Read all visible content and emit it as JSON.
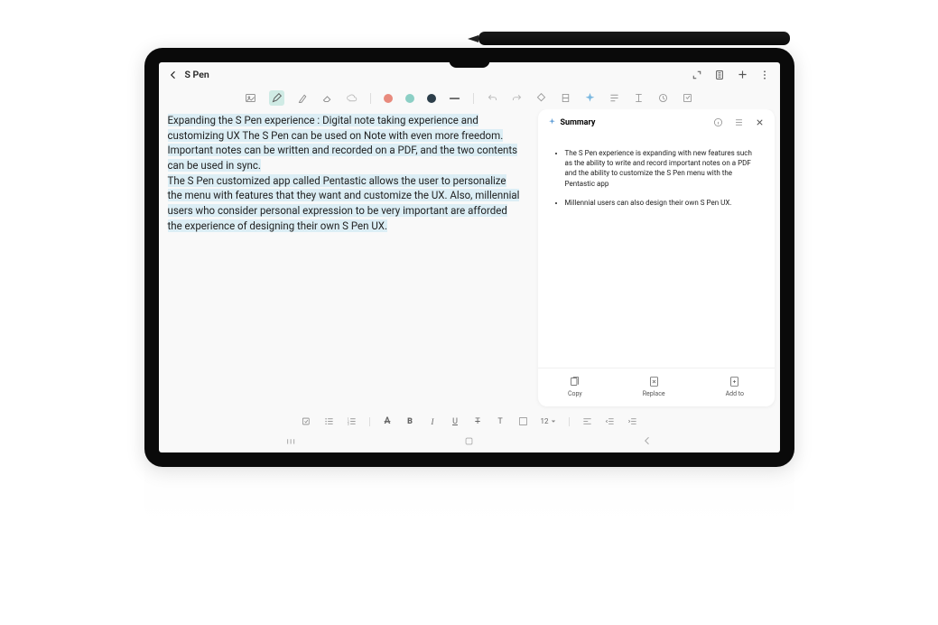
{
  "header": {
    "title": "S Pen"
  },
  "note": {
    "para1a": "Expanding the S Pen experience : Digital note taking experience and ",
    "para1b": "customizing UX The S Pen can be used on Note with even more freedom.",
    "para1c": "Important notes can be written and recorded on a PDF, and the two contents",
    "para1d": "can be used in sync.",
    "para2a": "The S Pen customized app called Pentastic allows the user to personalize ",
    "para2b": "the menu with features that they want and customize the UX. Also, millennial",
    "para2c": "users who consider personal expression to be very important are afforded",
    "para2d": "the experience of designing their own S Pen UX."
  },
  "summary": {
    "title": "Summary",
    "bullet1": "The S Pen experience is expanding with new features such as the ability to write and record important notes on a PDF and the ability to customize the S Pen menu with the Pentastic app",
    "bullet2": "Millennial users can also design their own S Pen UX."
  },
  "actions": {
    "copy": "Copy",
    "replace": "Replace",
    "addto": "Add to"
  },
  "bottom": {
    "fontsize": "12",
    "bold": "B",
    "italic": "I",
    "underline": "U"
  }
}
